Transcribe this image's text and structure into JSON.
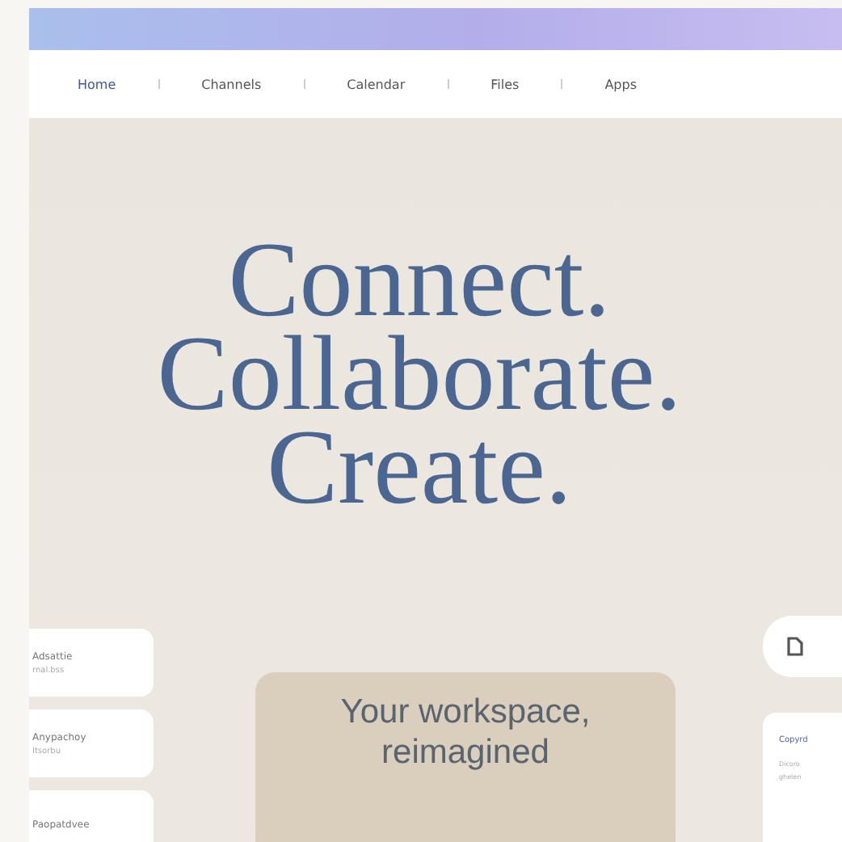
{
  "nav": {
    "items": [
      {
        "label": "Home",
        "selected": true
      },
      {
        "label": "Channels",
        "selected": false
      },
      {
        "label": "Calendar",
        "selected": false
      },
      {
        "label": "Files",
        "selected": false
      },
      {
        "label": "Apps",
        "selected": false
      }
    ]
  },
  "hero": {
    "headline": [
      "Connect.",
      "Collaborate.",
      "Create."
    ],
    "tagline": "Your workspace, reimagined"
  },
  "left_cards": [
    {
      "title": "Adsattie",
      "subtitle": "rnal.bss"
    },
    {
      "title": "Anypachoy",
      "subtitle": "Itsorbu"
    },
    {
      "title": "Paopatdvee"
    }
  ],
  "right_card": {
    "title": "Copyrd",
    "text": [
      "Dicoro",
      "ghelen"
    ]
  }
}
